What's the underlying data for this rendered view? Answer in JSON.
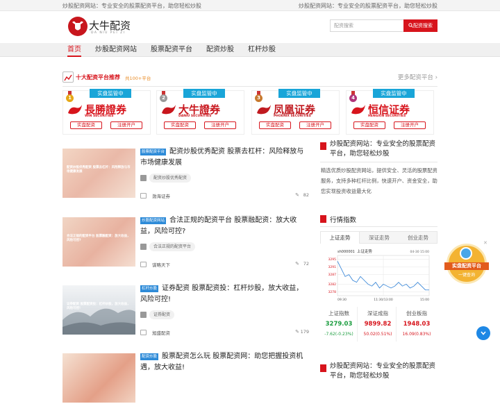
{
  "topbar": {
    "left": "炒股配资网站：专业安全的股票配资平台，助您轻松炒股",
    "right": "炒股配资网站：专业安全的股票配资平台，助您轻松炒股"
  },
  "logo": {
    "cn": "大牛配资",
    "en": "DA NIU PEI ZI"
  },
  "search": {
    "placeholder": "配资搜索",
    "button": "配资搜索"
  },
  "nav": [
    "首页",
    "炒股配资网站",
    "股票配资平台",
    "配资炒股",
    "杠杆炒股"
  ],
  "platforms": {
    "title": "十大配资平台推荐",
    "count": "共100+平台",
    "more": "更多配资平台",
    "badge": "实盘监管中",
    "btn_real": "实盘配资",
    "btn_reg": "注册开户",
    "items": [
      {
        "rank": "1",
        "name": "長勝證券",
        "sub": "WIN SECURITIES",
        "color": "#d7141c"
      },
      {
        "rank": "2",
        "name": "大牛證券",
        "sub": "DANIU SECURITIES",
        "color": "#c8161d"
      },
      {
        "rank": "3",
        "name": "凤凰证券",
        "sub": "PHOENIX SECURITIES",
        "color": "#c01a20"
      },
      {
        "rank": "4",
        "name": "恒信证券",
        "sub": "HENGXIN SECURITIES",
        "color": "#d7141c"
      }
    ]
  },
  "articles": [
    {
      "tag": "股票配资平台",
      "title": "配资炒股优秀配资 股票去杠杆：风险释放与市场健康发展",
      "topic": "配资炒股优秀配资",
      "author": "渤海证券",
      "views": "82",
      "overlay": "配资炒股优秀配资 股票去杠杆：风险释放与市场健康发展"
    },
    {
      "tag": "炒股配资网站",
      "title": "合法正规的配资平台 股票融配资：放大收益，风险可控?",
      "topic": "合法正规的配资平台",
      "author": "谋略天下",
      "views": "72",
      "overlay": "合法正规的配资平台 股票融配资：放大收益，风险可控?"
    },
    {
      "tag": "杠杆炒股",
      "title": "证券配资 股票配资投：杠杆炒股，放大收益，风险可控!",
      "topic": "证券配资",
      "author": "旭盛配资",
      "views": "179",
      "overlay": "证券配资 股票配资投：杠杆炒股，放大收益，风险可控!"
    },
    {
      "tag": "配资炒股",
      "title": "股票配资怎么玩 股票配资网：助您把握投资机遇，放大收益!",
      "topic": "",
      "author": "",
      "views": "",
      "overlay": ""
    }
  ],
  "sidebar": {
    "title": "炒股配资网站：专业安全的股票配资平台，助您轻松炒股",
    "desc": "精选优质炒股配资网站，提供安全、灵活的股票配资服务，支持多种杠杆比例，快速开户、资金安全，助您实现投资收益最大化",
    "market_title": "行情指数",
    "tabs": [
      "上证走势",
      "深证走势",
      "创业走势"
    ],
    "chart_code": "sh000001",
    "chart_label": "上证走势",
    "chart_time": "04-30 15:00",
    "quotes": [
      {
        "name": "上证指数",
        "value": "3279.03",
        "change": "-7.62(-0.23%)",
        "color": "#1a9c3e"
      },
      {
        "name": "深证成指",
        "value": "9899.82",
        "change": "50.02(0.51%)",
        "color": "#d7141c"
      },
      {
        "name": "创业板指",
        "value": "1948.03",
        "change": "16.09(0.83%)",
        "color": "#d7141c"
      }
    ],
    "title2": "炒股配资网站：专业安全的股票配资平台，助您轻松炒股"
  },
  "chart_data": {
    "type": "line",
    "title": "上证走势",
    "y_ticks": [
      "3295",
      "3291",
      "3287",
      "3282",
      "3278"
    ],
    "x_ticks": [
      "09:30",
      "11:30/13:00",
      "15:00"
    ],
    "ylim": [
      3276,
      3297
    ],
    "series": [
      {
        "values": [
          3294,
          3290,
          3286,
          3287,
          3284,
          3283,
          3286,
          3284,
          3282,
          3281,
          3283,
          3280,
          3282,
          3281,
          3280,
          3281,
          3283,
          3281,
          3282,
          3280,
          3281,
          3283,
          3281,
          3279,
          3279
        ]
      }
    ]
  },
  "float_ad": {
    "line1": "实盘配资平台",
    "line2": "一键查询"
  }
}
